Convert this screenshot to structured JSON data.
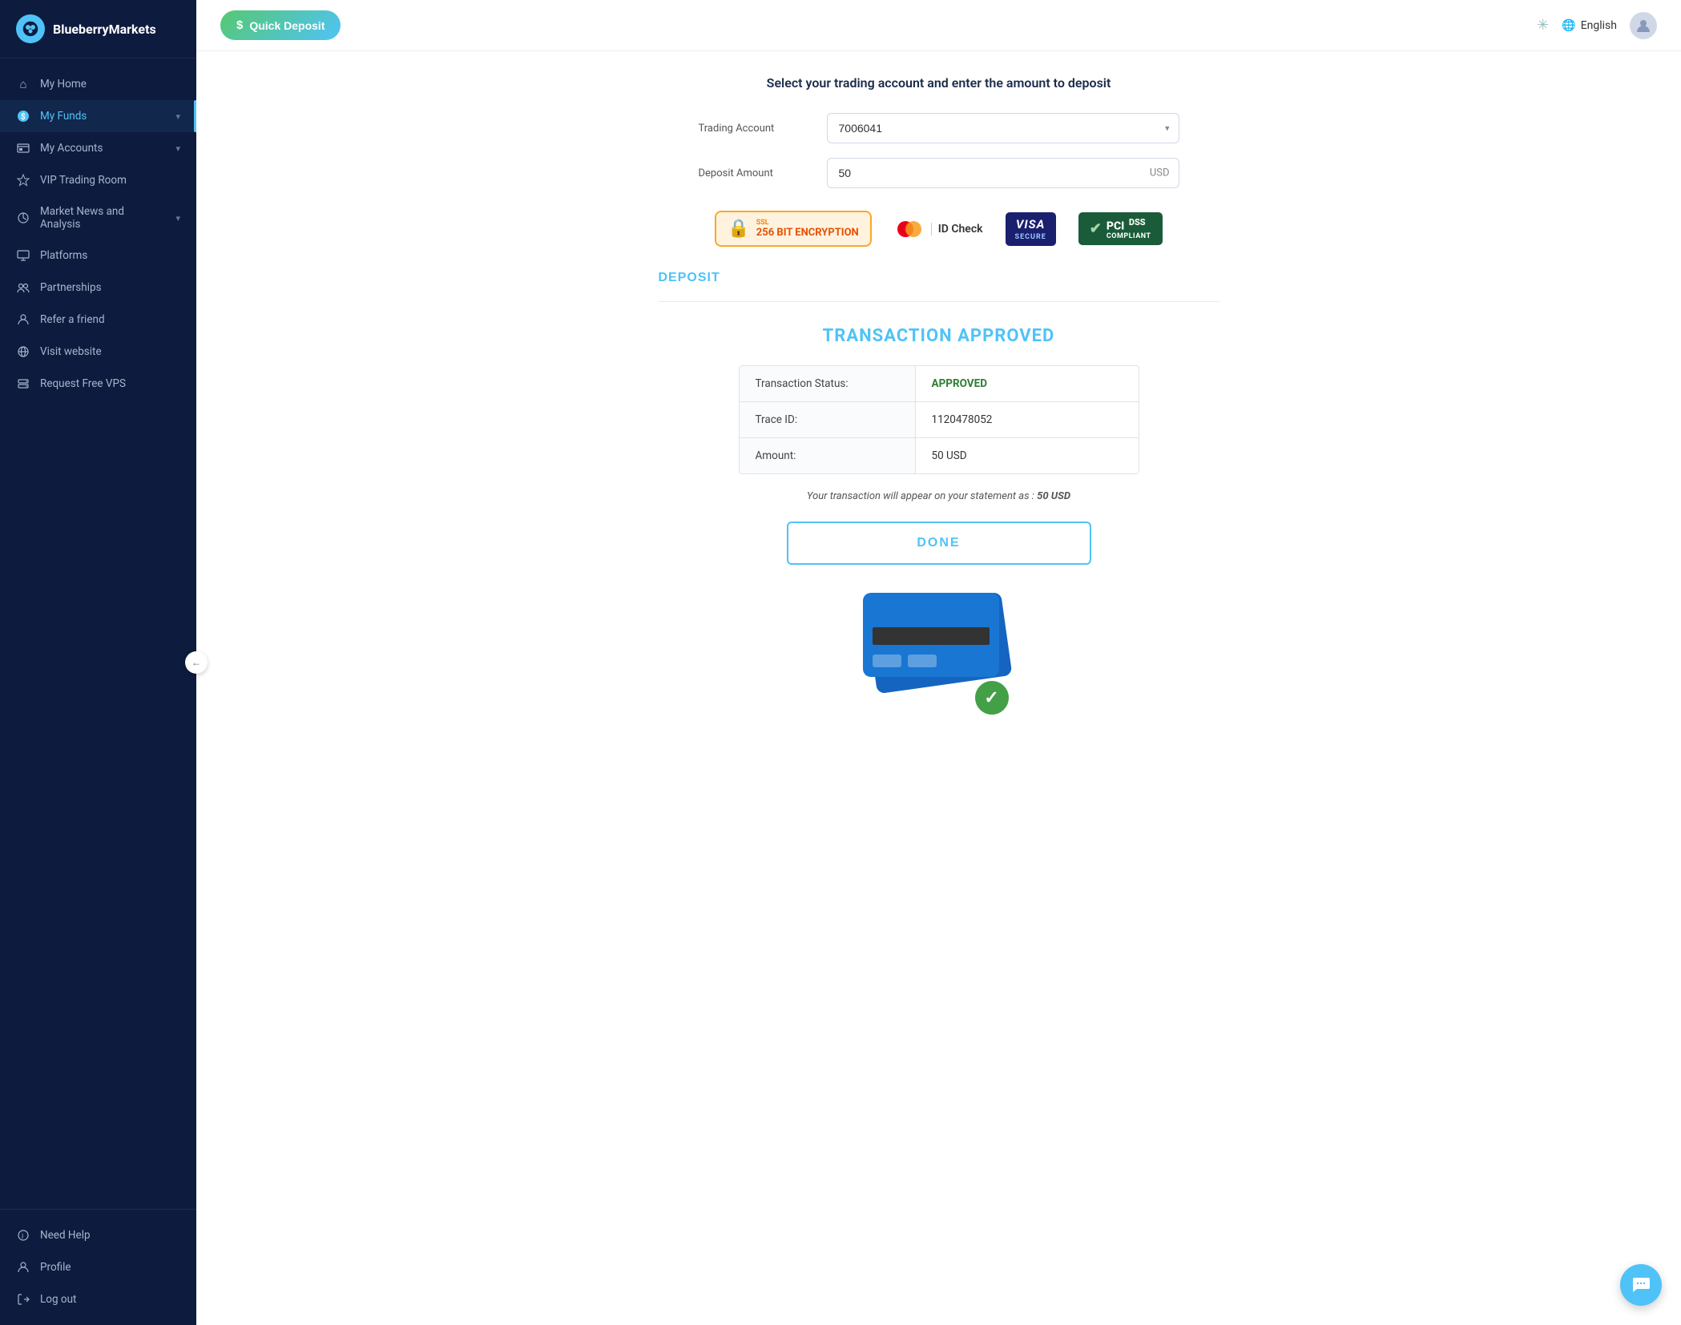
{
  "brand": {
    "name": "BlueberryMarkets",
    "logo_letter": "🫐"
  },
  "sidebar": {
    "items": [
      {
        "id": "my-home",
        "label": "My Home",
        "icon": "⌂",
        "active": false
      },
      {
        "id": "my-funds",
        "label": "My Funds",
        "icon": "💲",
        "active": true,
        "has_chevron": true
      },
      {
        "id": "my-accounts",
        "label": "My Accounts",
        "icon": "📊",
        "active": false,
        "has_chevron": true
      },
      {
        "id": "vip-trading-room",
        "label": "VIP Trading Room",
        "icon": "⭐",
        "active": false
      },
      {
        "id": "market-news",
        "label": "Market News and Analysis",
        "icon": "🎯",
        "active": false,
        "has_chevron": true
      },
      {
        "id": "platforms",
        "label": "Platforms",
        "icon": "🖥",
        "active": false
      },
      {
        "id": "partnerships",
        "label": "Partnerships",
        "icon": "🤝",
        "active": false
      },
      {
        "id": "refer-a-friend",
        "label": "Refer a friend",
        "icon": "👤",
        "active": false
      },
      {
        "id": "visit-website",
        "label": "Visit website",
        "icon": "🌐",
        "active": false
      },
      {
        "id": "request-free-vps",
        "label": "Request Free VPS",
        "icon": "🖨",
        "active": false
      }
    ],
    "bottom_items": [
      {
        "id": "need-help",
        "label": "Need Help",
        "icon": "ⓘ"
      },
      {
        "id": "profile",
        "label": "Profile",
        "icon": "👤"
      },
      {
        "id": "log-out",
        "label": "Log out",
        "icon": "↩"
      }
    ]
  },
  "header": {
    "quick_deposit_label": "Quick Deposit",
    "language": "English",
    "lang_icon": "🌐"
  },
  "deposit_form": {
    "section_title": "Select your trading account and enter the amount to deposit",
    "trading_account_label": "Trading Account",
    "trading_account_value": "7006041",
    "deposit_amount_label": "Deposit Amount",
    "deposit_amount_value": "50",
    "deposit_amount_currency": "USD",
    "deposit_button_label": "DEPOSIT"
  },
  "security_badges": {
    "badge_256": "256 BIT ENCRYPTION",
    "badge_idcheck": "ID Check",
    "badge_visa": "VISA",
    "badge_visa_sub": "SECURE",
    "badge_pci": "PCI",
    "badge_dss": "DSS",
    "badge_compliant": "COMPLIANT"
  },
  "transaction": {
    "title": "TRANSACTION APPROVED",
    "rows": [
      {
        "label": "Transaction Status:",
        "value": "APPROVED",
        "status": true
      },
      {
        "label": "Trace ID:",
        "value": "1120478052"
      },
      {
        "label": "Amount:",
        "value": "50 USD"
      }
    ],
    "statement_text": "Your transaction will appear on your statement as :",
    "statement_amount": "50 USD",
    "done_label": "DONE"
  },
  "chat": {
    "icon": "💬"
  }
}
